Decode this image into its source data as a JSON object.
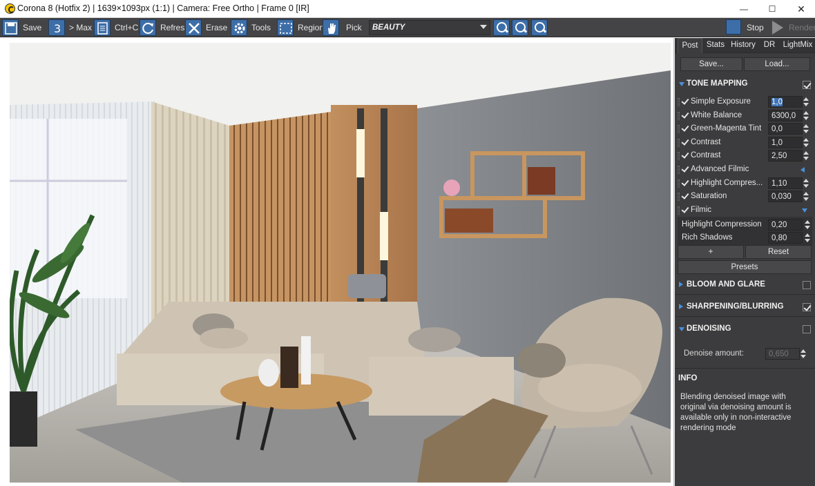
{
  "window": {
    "title": "Corona 8 (Hotfix 2) | 1639×1093px (1:1) | Camera: Free Ortho | Frame 0 [IR]",
    "min_glyph": "—",
    "max_glyph": "☐",
    "close_glyph": "✕"
  },
  "toolbar": {
    "save": "Save",
    "max": "> Max",
    "ctrlc": "Ctrl+C",
    "refresh": "Refresh",
    "erase": "Erase",
    "tools": "Tools",
    "region": "Region",
    "pick": "Pick",
    "channel": "BEAUTY",
    "stop": "Stop",
    "render": "Render"
  },
  "icons": {
    "save": "save-icon",
    "max": "max-3-icon",
    "ctrlc": "copy-icon",
    "refresh": "refresh-icon",
    "erase": "erase-icon",
    "tools": "gear-icon",
    "region": "region-icon",
    "pick": "hand-icon",
    "zoom_in": "zoom-in-icon",
    "zoom_out": "zoom-out-icon",
    "zoom_fit": "zoom-fit-icon",
    "stop": "stop-icon",
    "render": "render-play-icon"
  },
  "panel": {
    "tabs": [
      "Post",
      "Stats",
      "History",
      "DR",
      "LightMix"
    ],
    "active_tab": "Post",
    "save_btn": "Save...",
    "load_btn": "Load...",
    "tone_mapping": {
      "title": "TONE MAPPING",
      "enabled": true,
      "rows": [
        {
          "label": "Simple Exposure",
          "value": "1,0",
          "checked": true,
          "selected": true
        },
        {
          "label": "White Balance",
          "value": "6300,0",
          "checked": true
        },
        {
          "label": "Green-Magenta Tint",
          "value": "0,0",
          "checked": true
        },
        {
          "label": "Contrast",
          "value": "1,0",
          "checked": true
        },
        {
          "label": "Contrast",
          "value": "2,50",
          "checked": true
        },
        {
          "label": "Advanced Filmic",
          "value": "",
          "checked": true
        },
        {
          "label": "Highlight Compres...",
          "value": "1,10",
          "checked": true
        },
        {
          "label": "Saturation",
          "value": "0,030",
          "checked": true
        },
        {
          "label": "Filmic",
          "value": "",
          "checked": true
        }
      ],
      "filmic": [
        {
          "label": "Highlight Compression",
          "value": "0,20"
        },
        {
          "label": "Rich Shadows",
          "value": "0,80"
        }
      ],
      "plus_btn": "+",
      "reset_btn": "Reset",
      "presets_btn": "Presets"
    },
    "bloom": {
      "title": "BLOOM AND GLARE",
      "enabled": false
    },
    "sharpen": {
      "title": "SHARPENING/BLURRING",
      "enabled": true
    },
    "denoise": {
      "title": "DENOISING",
      "enabled": false,
      "label": "Denoise amount:",
      "value": "0,650"
    },
    "info": {
      "title": "INFO",
      "text": "Blending denoised image with original via denoising amount is available only in non-interactive rendering mode"
    }
  },
  "colors": {
    "toolbar_bg": "#444446",
    "panel_bg": "#3c3c3e",
    "accent_blue": "#3d6ea8",
    "section_triangle": "#4a90d9"
  }
}
